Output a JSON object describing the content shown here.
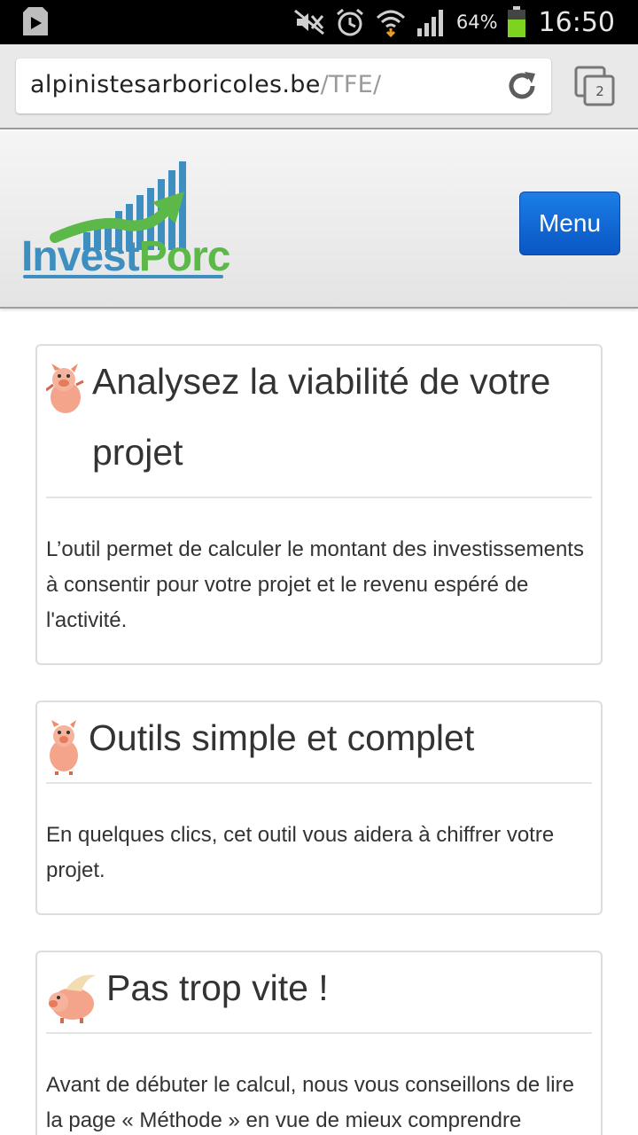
{
  "status_bar": {
    "battery_percent": "64%",
    "time": "16:50",
    "icons": [
      "play-store-icon",
      "mute-icon",
      "alarm-icon",
      "wifi-icon",
      "signal-icon",
      "battery-icon"
    ]
  },
  "browser": {
    "url_domain": "alpinistesarboricoles.be",
    "url_path": "/TFE/",
    "tab_count": "2"
  },
  "header": {
    "logo_part1": "Invest",
    "logo_part2": "Porc",
    "menu_label": "Menu"
  },
  "cards": [
    {
      "title": "Analysez la viabilité de votre projet",
      "body": "L’outil permet de calculer le montant des investissements à consentir pour votre projet et le revenu espéré de l'activité."
    },
    {
      "title": "Outils simple et complet",
      "body": "En quelques clics, cet outil vous aidera à chiffrer votre projet."
    },
    {
      "title": "Pas trop vite !",
      "body": "Avant de débuter le calcul, nous vous conseillons de lire la page « Méthode » en vue de mieux comprendre"
    }
  ],
  "colors": {
    "menu_button": "#0a6ad8",
    "logo_blue": "#3e8fbf",
    "logo_green": "#5bb849"
  }
}
